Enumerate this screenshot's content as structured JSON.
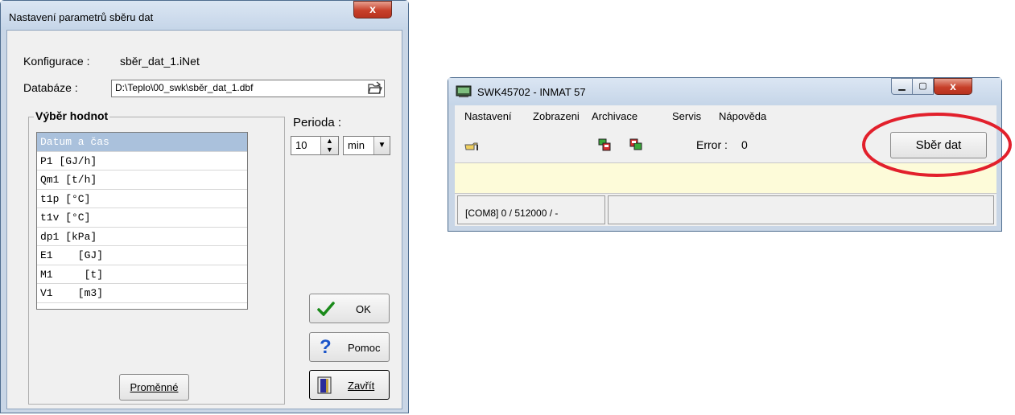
{
  "dialog": {
    "title": "Nastavení parametrů sběru dat",
    "close_glyph": "x",
    "config_label": "Konfigurace :",
    "config_value": "sběr_dat_1.iNet",
    "db_label": "Databáze :",
    "db_path": "D:\\Teplo\\00_swk\\sběr_dat_1.dbf",
    "group_label": "Výběr hodnot",
    "list_items": [
      "Datum a čas",
      "P1 [GJ/h]",
      "Qm1 [t/h]",
      "t1p [°C]",
      "t1v [°C]",
      "dp1 [kPa]",
      "E1    [GJ]",
      "M1     [t]",
      "V1    [m3]"
    ],
    "selected_index": 0,
    "variables_button": "Proměnné",
    "period_label": "Perioda :",
    "period_value": "10",
    "period_unit": "min",
    "ok_button": "OK",
    "help_button": "Pomoc",
    "close_button": "Zavřít"
  },
  "window": {
    "title": "SWK45702 - INMAT 57",
    "menu": [
      "Nastavení",
      "Zobrazeni",
      "Archivace",
      "Servis",
      "Nápověda"
    ],
    "error_label": "Error :",
    "error_value": "0",
    "collect_button": "Sběr dat",
    "status_text": "[COM8]  0 / 512000 / -",
    "highlight_color": "#e2202c"
  }
}
